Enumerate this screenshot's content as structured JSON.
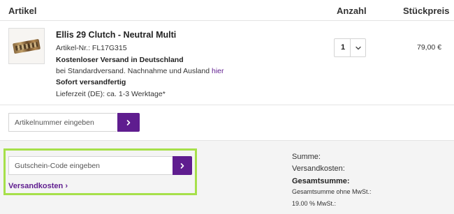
{
  "header": {
    "article": "Artikel",
    "quantity": "Anzahl",
    "unit_price": "Stückpreis"
  },
  "item": {
    "name": "Ellis 29 Clutch - Neutral Multi",
    "article_number": "Artikel-Nr.: FL17G315",
    "shipping_free": "Kostenloser Versand in Deutschland",
    "shipping_note": "bei Standardversand. Nachnahme und Ausland",
    "shipping_note_link": "hier",
    "ready": "Sofort versandfertig",
    "delivery": "Lieferzeit (DE): ca. 1-3 Werktage*",
    "quantity": "1",
    "price": "79,00 €",
    "image_icon": "clutch-bag-image"
  },
  "article_number_entry": {
    "placeholder": "Artikelnummer eingeben",
    "submit_icon": "chevron-right-icon"
  },
  "voucher": {
    "placeholder": "Gutschein-Code eingeben",
    "submit_icon": "chevron-right-icon",
    "shipping_costs_link": "Versandkosten ›",
    "highlight_color": "#a6e04a"
  },
  "summary": {
    "subtotal_label": "Summe:",
    "shipping_label": "Versandkosten:",
    "total_label": "Gesamtsumme:",
    "total_net_label": "Gesamtsumme ohne MwSt.:",
    "vat_label": "19.00 % MwSt.:"
  },
  "colors": {
    "accent": "#5f1d8f",
    "highlight": "#a6e04a",
    "panel": "#f4f4f4"
  }
}
